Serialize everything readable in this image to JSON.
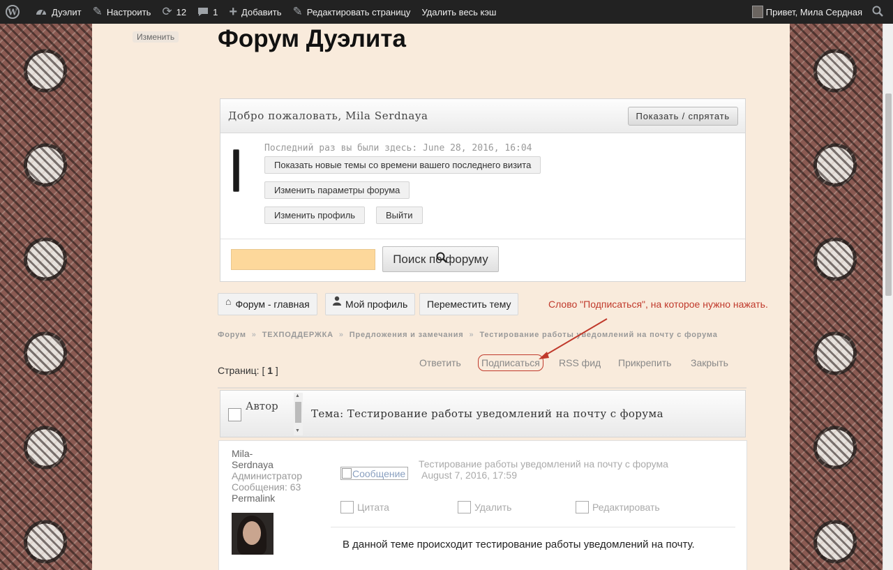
{
  "adminbar": {
    "site_name": "Дуэлит",
    "customize": "Настроить",
    "updates_count": "12",
    "comments_count": "1",
    "add_new": "Добавить",
    "edit_page": "Редактировать страницу",
    "clear_cache": "Удалить весь кэш",
    "greeting": "Привет, Мила Сердная"
  },
  "page": {
    "edit_link": "Изменить",
    "title": "Форум Дуэлита"
  },
  "welcome": {
    "title": "Добро пожаловать, Mila Serdnaya",
    "toggle_label": "Показать / спрятать",
    "last_visit": "Последний раз вы были здесь: June 28, 2016, 16:04",
    "new_topics_btn": "Показать новые темы со времени вашего последнего визита",
    "forum_settings_btn": "Изменить параметры форума",
    "edit_profile_btn": "Изменить профиль",
    "logout_btn": "Выйти",
    "search_value": "",
    "search_btn": "Поиск по форуму"
  },
  "nav": {
    "forum_home": "Форум - главная",
    "my_profile": "Мой профиль",
    "move_topic": "Переместить тему"
  },
  "annotation": "Слово \"Подписаться\", на которое нужно нажать.",
  "breadcrumb": [
    "Форум",
    "ТЕХПОДДЕРЖКА",
    "Предложения и замечания",
    "Тестирование работы уведомлений на почту с форума"
  ],
  "breadcrumb_sep": "»",
  "pagination": {
    "label": "Страниц: [",
    "current": "1",
    "close": "]"
  },
  "actions": {
    "reply": "Ответить",
    "subscribe": "Подписаться",
    "rss": "RSS фид",
    "pin": "Прикрепить",
    "close": "Закрыть"
  },
  "topic": {
    "author_label": "Автор",
    "title": "Тема: Тестирование работы уведомлений на почту с форума"
  },
  "post": {
    "author_name_1": "Mila-",
    "author_name_2": "Serdnaya",
    "author_role": "Администратор",
    "author_posts": "Сообщения: 63",
    "permalink": "Permalink",
    "message_img_alt": "Сообщение",
    "subject": "Тестирование работы уведомлений на почту с форума",
    "date": "August 7, 2016, 17:59",
    "quote": "Цитата",
    "delete": "Удалить",
    "edit": "Редактировать",
    "body": "В данной теме происходит тестирование работы уведомлений на почту."
  },
  "colors": {
    "admin_bar": "#222222",
    "page_bg": "#f9ebdc",
    "search_field": "#fdd89b",
    "annotation_red": "#c0392b"
  }
}
